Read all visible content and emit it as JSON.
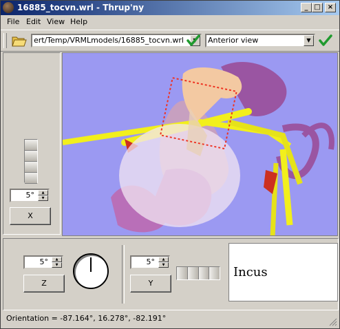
{
  "window": {
    "title": "16885_tocvn.wrl - Thrup'ny"
  },
  "menu": [
    "File",
    "Edit",
    "View",
    "Help"
  ],
  "toolbar": {
    "path_value": "ert/Temp/VRMLmodels/16885_tocvn.wrl",
    "view_value": "Anterior view"
  },
  "left_panel": {
    "step_value": "5°",
    "axis_button": "X"
  },
  "bottom_panel": {
    "z_step_value": "5°",
    "z_button": "Z",
    "y_step_value": "5°",
    "y_button": "Y",
    "selected_part": "Incus"
  },
  "status": {
    "orientation": "Orientation = -87.164°, 16.278°, -82.191°"
  },
  "colors": {
    "titlebar_start": "#0a246a",
    "titlebar_end": "#a6caf0",
    "viewport_background": "#9b99f2",
    "check_green": "#1f9a2e",
    "nerve_yellow": "#f2ef1c"
  },
  "icons": [
    "app-icon",
    "minimize-icon",
    "maximize-icon",
    "close-icon",
    "folder-open-icon",
    "apply-checkmark-icon",
    "apply-view-checkmark-icon"
  ]
}
